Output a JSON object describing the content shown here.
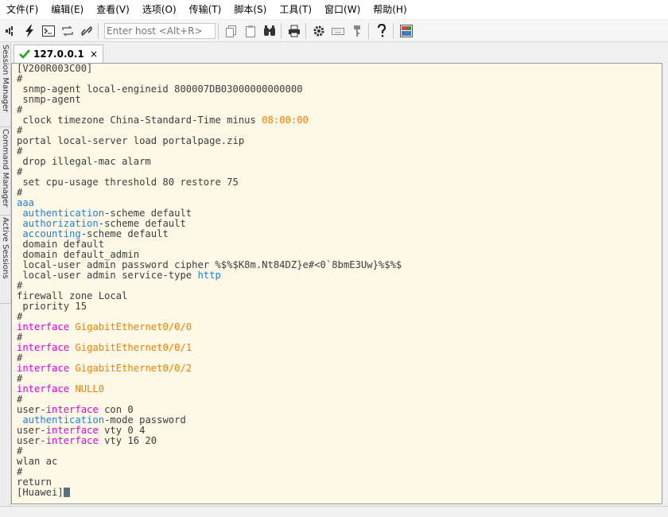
{
  "menu": [
    "文件(F)",
    "编辑(E)",
    "查看(V)",
    "选项(O)",
    "传输(T)",
    "脚本(S)",
    "工具(T)",
    "窗口(W)",
    "帮助(H)"
  ],
  "toolbar": {
    "host_placeholder": "Enter host <Alt+R>",
    "icons": [
      "connect-icon",
      "quick-connect-icon",
      "terminal-icon",
      "reconnect-icon",
      "disconnect-icon",
      "copy-icon",
      "paste-icon",
      "find-icon",
      "print-icon",
      "settings-icon",
      "keymap-icon",
      "key-icon",
      "help-icon",
      "sftp-icon"
    ]
  },
  "side_tabs": [
    "Session Manager",
    "Command Manager",
    "Active Sessions"
  ],
  "tab": {
    "title": "127.0.0.1",
    "close": "×"
  },
  "terminal": {
    "lines": [
      [
        {
          "t": "[V200R003C00]"
        }
      ],
      [
        {
          "t": "#"
        }
      ],
      [
        {
          "t": " snmp-agent local-engineid 800007DB03000000000000"
        }
      ],
      [
        {
          "t": " snmp-agent"
        }
      ],
      [
        {
          "t": "#"
        }
      ],
      [
        {
          "t": " clock timezone China-Standard-Time minus "
        },
        {
          "t": "08:00:00",
          "c": "orange"
        }
      ],
      [
        {
          "t": "#"
        }
      ],
      [
        {
          "t": "portal local-server load portalpage.zip"
        }
      ],
      [
        {
          "t": "#"
        }
      ],
      [
        {
          "t": " drop illegal-mac alarm"
        }
      ],
      [
        {
          "t": "#"
        }
      ],
      [
        {
          "t": " set cpu-usage threshold 80 restore 75"
        }
      ],
      [
        {
          "t": "#"
        }
      ],
      [
        {
          "t": "aaa",
          "c": "blue"
        }
      ],
      [
        {
          "t": " "
        },
        {
          "t": "authentication",
          "c": "blue"
        },
        {
          "t": "-scheme default"
        }
      ],
      [
        {
          "t": " "
        },
        {
          "t": "authorization",
          "c": "blue"
        },
        {
          "t": "-scheme default"
        }
      ],
      [
        {
          "t": " "
        },
        {
          "t": "accounting",
          "c": "blue"
        },
        {
          "t": "-scheme default"
        }
      ],
      [
        {
          "t": " domain default"
        }
      ],
      [
        {
          "t": " domain default_admin"
        }
      ],
      [
        {
          "t": " local-user admin password cipher %$%$K8m.Nt84DZ}e#<0`8bmE3Uw}%$%$"
        }
      ],
      [
        {
          "t": " local-user admin service-type "
        },
        {
          "t": "http",
          "c": "blue"
        }
      ],
      [
        {
          "t": "#"
        }
      ],
      [
        {
          "t": "firewall zone Local"
        }
      ],
      [
        {
          "t": " priority 15"
        }
      ],
      [
        {
          "t": "#"
        }
      ],
      [
        {
          "t": "interface",
          "c": "magenta"
        },
        {
          "t": " "
        },
        {
          "t": "GigabitEthernet0/0/0",
          "c": "orange"
        }
      ],
      [
        {
          "t": "#"
        }
      ],
      [
        {
          "t": "interface",
          "c": "magenta"
        },
        {
          "t": " "
        },
        {
          "t": "GigabitEthernet0/0/1",
          "c": "orange"
        }
      ],
      [
        {
          "t": "#"
        }
      ],
      [
        {
          "t": "interface",
          "c": "magenta"
        },
        {
          "t": " "
        },
        {
          "t": "GigabitEthernet0/0/2",
          "c": "orange"
        }
      ],
      [
        {
          "t": "#"
        }
      ],
      [
        {
          "t": "interface",
          "c": "magenta"
        },
        {
          "t": " "
        },
        {
          "t": "NULL0",
          "c": "orange"
        }
      ],
      [
        {
          "t": "#"
        }
      ],
      [
        {
          "t": "user-"
        },
        {
          "t": "interface",
          "c": "magenta"
        },
        {
          "t": " con 0"
        }
      ],
      [
        {
          "t": " "
        },
        {
          "t": "authentication",
          "c": "blue"
        },
        {
          "t": "-mode password"
        }
      ],
      [
        {
          "t": "user-"
        },
        {
          "t": "interface",
          "c": "magenta"
        },
        {
          "t": " vty 0 4"
        }
      ],
      [
        {
          "t": "user-"
        },
        {
          "t": "interface",
          "c": "magenta"
        },
        {
          "t": " vty 16 20"
        }
      ],
      [
        {
          "t": "#"
        }
      ],
      [
        {
          "t": "wlan ac"
        }
      ],
      [
        {
          "t": "#"
        }
      ],
      [
        {
          "t": "return"
        }
      ],
      [
        {
          "t": "[Huawei]"
        }
      ]
    ],
    "colors": {
      "background": "#fef9e7",
      "text": "#3c3c3c",
      "blue": "#1e7fd6",
      "magenta": "#e000e0",
      "orange": "#f08000"
    }
  }
}
